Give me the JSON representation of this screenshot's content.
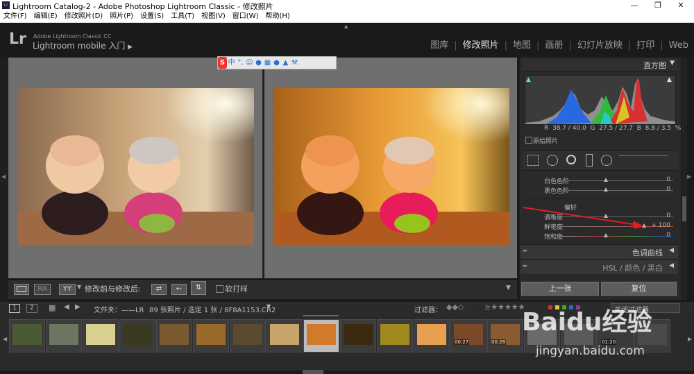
{
  "window": {
    "title": "Lightroom Catalog-2 - Adobe Photoshop Lightroom Classic - 修改照片",
    "app_icon": "Lr"
  },
  "menu": [
    "文件(F)",
    "编辑(E)",
    "修改照片(D)",
    "照片(P)",
    "设置(S)",
    "工具(T)",
    "视图(V)",
    "窗口(W)",
    "帮助(H)"
  ],
  "identity": {
    "logo": "Lr",
    "product": "Adobe Lightroom Classic CC",
    "mobile": "Lightroom mobile 入门"
  },
  "modules": [
    "图库",
    "修改照片",
    "地图",
    "画册",
    "幻灯片放映",
    "打印",
    "Web"
  ],
  "modules_active": "修改照片",
  "ime": {
    "logo": "S",
    "lang": "中"
  },
  "histogram": {
    "title": "直方图",
    "rgb_readout": "R  38.7 / 40.0  G  27.5 / 27.7  B  8.8 / 3.5  %",
    "original_label": "原始照片"
  },
  "basic": {
    "rows": [
      {
        "label": "白色色阶",
        "value": "0",
        "pos": 0.5
      },
      {
        "label": "黑色色阶",
        "value": "0",
        "pos": 0.5
      }
    ],
    "presence_title": "偏好",
    "presence": [
      {
        "label": "清晰度",
        "value": "0",
        "pos": 0.5
      },
      {
        "label": "鲜艳度",
        "value": "+ 100",
        "pos": 1.0
      },
      {
        "label": "饱和度",
        "value": "0",
        "pos": 0.5
      }
    ]
  },
  "panels": {
    "tone_curve": "色调曲线",
    "hsl": "HSL",
    "color": "颜色",
    "bw": "黑白"
  },
  "buttons": {
    "previous": "上一张",
    "reset": "复位"
  },
  "toolbar": {
    "yy": "YY",
    "before_after": "修改前与修改后:",
    "soft_proof": "软打样"
  },
  "secondary": {
    "page1": "1",
    "page2": "2",
    "folder": "文件夹：——LR",
    "info": "89 张照片 / 选定 1 张 / 8F8A1153.CR2",
    "filter_label": "过滤器：",
    "filter_off": "关闭过滤器"
  },
  "filmstrip": {
    "count": 18,
    "selected_index": 8,
    "labels": [
      "",
      "",
      "",
      "",
      "",
      "",
      "",
      "",
      "",
      "",
      "",
      "",
      "00:27",
      "00:28",
      "",
      "",
      "01:20",
      ""
    ]
  },
  "watermark": {
    "brand": "Baidu经验",
    "url": "jingyan.baidu.com"
  }
}
